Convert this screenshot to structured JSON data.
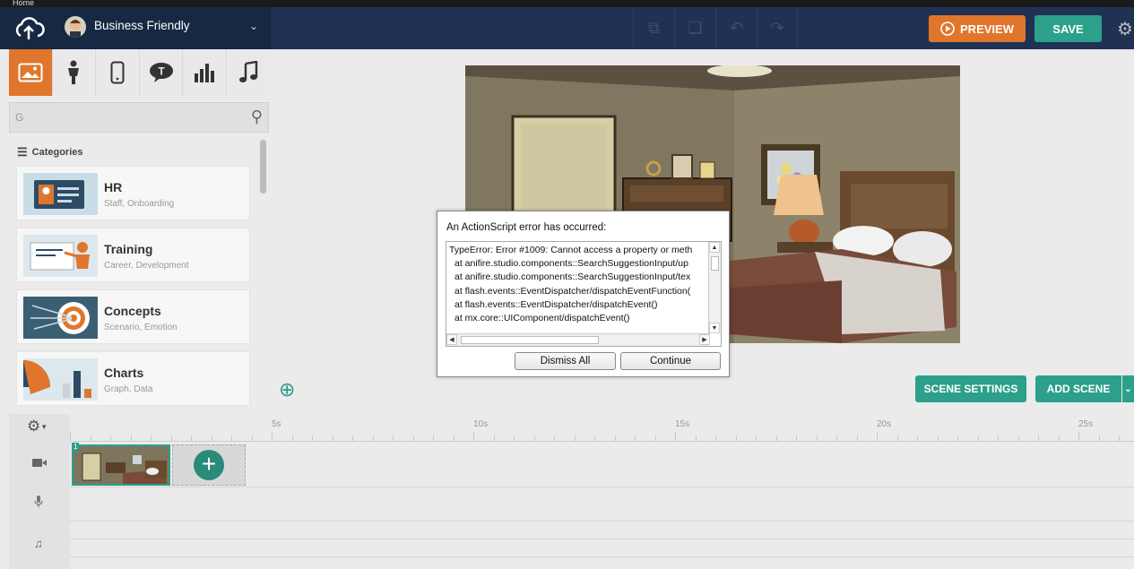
{
  "titlebar": {
    "text": "Home"
  },
  "header": {
    "theme_name": "Business Friendly",
    "preview_label": "PREVIEW",
    "save_label": "SAVE"
  },
  "search": {
    "value": "G"
  },
  "library": {
    "categories_label": "Categories",
    "items": [
      {
        "title": "HR",
        "subtitle": "Staff, Onboarding"
      },
      {
        "title": "Training",
        "subtitle": "Career, Development"
      },
      {
        "title": "Concepts",
        "subtitle": "Scenario, Emotion"
      },
      {
        "title": "Charts",
        "subtitle": "Graph, Data"
      }
    ]
  },
  "stage": {
    "scene_settings_label": "SCENE SETTINGS",
    "add_scene_label": "ADD SCENE"
  },
  "timeline": {
    "ruler_labels": [
      "5s",
      "10s",
      "15s",
      "20s",
      "25s"
    ],
    "scene_number": "1"
  },
  "dialog": {
    "title": "An ActionScript error has occurred:",
    "lines": [
      "TypeError: Error #1009: Cannot access a property or meth",
      "at anifire.studio.components::SearchSuggestionInput/up",
      "at anifire.studio.components::SearchSuggestionInput/tex",
      "at flash.events::EventDispatcher/dispatchEventFunction(",
      "at flash.events::EventDispatcher/dispatchEvent()",
      "at mx.core::UIComponent/dispatchEvent()"
    ],
    "dismiss_label": "Dismiss All",
    "continue_label": "Continue"
  },
  "colors": {
    "accent_orange": "#e0762b",
    "accent_teal": "#2ca08b",
    "header_navy": "#1f3253"
  }
}
